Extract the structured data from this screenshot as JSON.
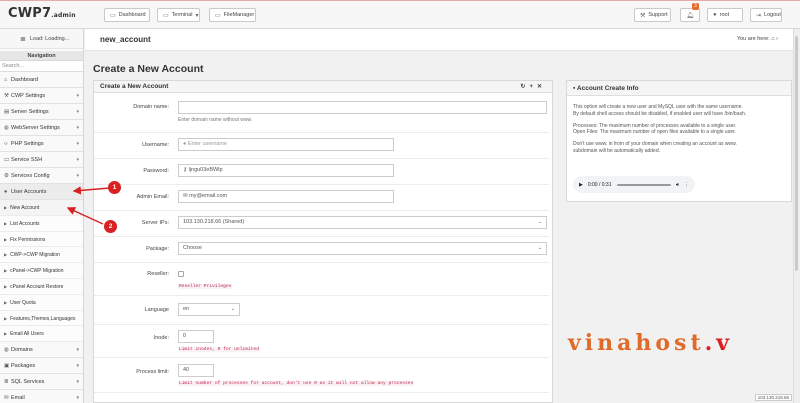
{
  "app": {
    "logo": "CWP7",
    "logo_suffix": ".admin"
  },
  "topbar": {
    "dashboard": "Dashboard",
    "terminal": "Terminal",
    "filemanager": "FileManager",
    "support": "Support",
    "notifications_count": "3",
    "user": "root",
    "logout": "Logout"
  },
  "sidebar": {
    "loading": "Load: Loading...",
    "nav_heading": "Navigation",
    "search_placeholder": "Search...",
    "items_top": [
      {
        "label": "Dashboard",
        "icon": "home-icon"
      },
      {
        "label": "CWP Settings",
        "icon": "wrench-icon"
      },
      {
        "label": "Server Settings",
        "icon": "server-icon"
      },
      {
        "label": "WebServer Settings",
        "icon": "globe-icon"
      },
      {
        "label": "PHP Settings",
        "icon": "code-icon"
      },
      {
        "label": "Service SSH",
        "icon": "terminal-icon"
      },
      {
        "label": "Services Config",
        "icon": "cog-icon"
      },
      {
        "label": "User Accounts",
        "icon": "user-icon"
      }
    ],
    "sub_items": [
      "New Account",
      "List Accounts",
      "Fix Permissions",
      "CWP->CWP Migration",
      "cPanel->CWP Migration",
      "cPanel Account Restore",
      "User Quota",
      "Features,Themes,Languages",
      "Email All Users"
    ],
    "items_bottom": [
      {
        "label": "Domains",
        "icon": "globe-icon"
      },
      {
        "label": "Packages",
        "icon": "box-icon"
      },
      {
        "label": "SQL Services",
        "icon": "database-icon"
      },
      {
        "label": "Email",
        "icon": "envelope-icon"
      }
    ]
  },
  "page": {
    "header_title": "new_account",
    "breadcrumb": "You are here:",
    "heading": "Create a New Account"
  },
  "form": {
    "panel_title": "Create a New Account",
    "domain_label": "Domain name:",
    "domain_help": "Enter domain name without www.",
    "username_label": "Username:",
    "username_placeholder": "Enter username",
    "password_label": "Password:",
    "password_value": "ljngu03eBWlp",
    "email_label": "Admin Email:",
    "email_value": "my@email.com",
    "ip_label": "Server IPs:",
    "ip_value": "103.130.218.66 (Shared)",
    "package_label": "Package:",
    "package_value": "Choose",
    "reseller_label": "Reseller:",
    "reseller_help": "Reseller Privileges",
    "language_label": "Language",
    "language_value": "en",
    "inode_label": "Inode:",
    "inode_value": "0",
    "inode_help": "Limit inodes, 0 for unlimited",
    "process_label": "Process limit:",
    "process_value": "40",
    "process_help": "Limit number of processes for account, don't use 0 as it will not allow any processes"
  },
  "info": {
    "panel_title": "Account Create Info",
    "p1": "This option will create a new user and MySQL user with the same username.",
    "p2": "By default shell access should be disabled, if enabled user will have /bin/bash.",
    "p3": "Processes: The maximum number of processes available to a single user.",
    "p4": "Open Files: The maximum number of open files available to a single user.",
    "p5": "Don't use www. in from of your domain when creating an account as www.",
    "p6": "subdomain will be automatically added.",
    "audio_time": "0:00 / 0:31"
  },
  "annotations": {
    "marker1": "1",
    "marker2": "2",
    "color": "#d92121"
  },
  "watermark": {
    "text": "vinahost",
    "suffix": ".v"
  },
  "status": {
    "ip": "103.130.218.66"
  }
}
